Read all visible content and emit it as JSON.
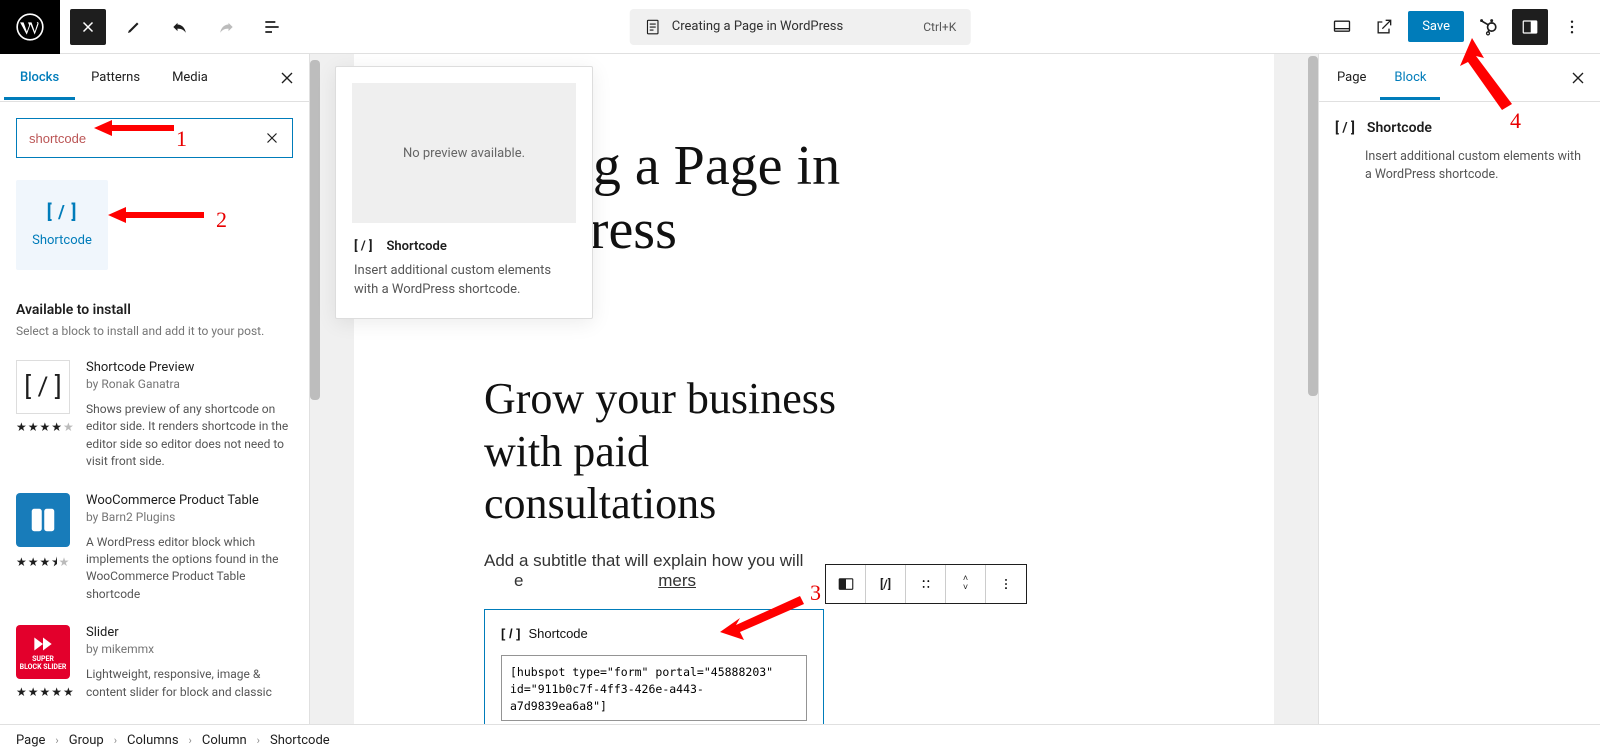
{
  "topbar": {
    "doc_title": "Creating a Page in WordPress",
    "shortcut": "Ctrl+K",
    "save_label": "Save"
  },
  "inserter": {
    "tabs": {
      "blocks": "Blocks",
      "patterns": "Patterns",
      "media": "Media"
    },
    "search_value": "shortcode",
    "result_label": "Shortcode",
    "available_heading": "Available to install",
    "available_sub": "Select a block to install and add it to your post.",
    "dir": [
      {
        "title": "Shortcode Preview",
        "by": "by Ronak Ganatra",
        "stars": "★★★★",
        "dim": "★",
        "desc": "Shows preview of any shortcode on editor side. It renders shortcode in the editor side so editor does not need to visit front side."
      },
      {
        "title": "WooCommerce Product Table",
        "by": "by Barn2 Plugins",
        "stars": "★★★",
        "half": "⯨",
        "dim": "★",
        "desc": "A WordPress editor block which implements the options found in the WooCommerce Product Table shortcode"
      },
      {
        "title": "Slider",
        "by": "by mikemmx",
        "stars": "★★★★★",
        "dim": "",
        "desc": "Lightweight, responsive, image & content slider for block and classic"
      }
    ]
  },
  "flyout": {
    "no_preview": "No preview available.",
    "title": "Shortcode",
    "desc": "Insert additional custom elements with a WordPress shortcode."
  },
  "canvas": {
    "h1a": "eating a Page in",
    "h1b": "ordPress",
    "h2a": "Grow your business",
    "h2b": "with paid",
    "h2c": "consultations",
    "sub1": "Add a subtitle that will explain how you will",
    "sub2_pre": "e",
    "sub2_u": "mers",
    "sc_label": "Shortcode",
    "sc_value": "[hubspot type=\"form\" portal=\"45888203\" id=\"911b0c7f-4ff3-426e-a443-a7d9839ea6a8\"]"
  },
  "settings": {
    "tab_page": "Page",
    "tab_block": "Block",
    "title": "Shortcode",
    "desc": "Insert additional custom elements with a WordPress shortcode."
  },
  "crumbs": [
    "Page",
    "Group",
    "Columns",
    "Column",
    "Shortcode"
  ],
  "annotations": {
    "n1": "1",
    "n2": "2",
    "n3": "3",
    "n4": "4"
  }
}
